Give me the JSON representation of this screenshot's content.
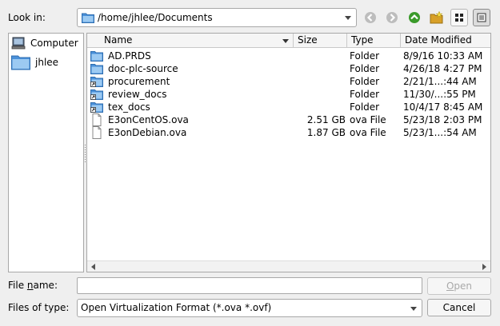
{
  "lookin": {
    "label": "Look in:",
    "path": "/home/jhlee/Documents"
  },
  "toolbar": {
    "back_icon": "arrow-left-icon",
    "forward_icon": "arrow-right-icon",
    "up_icon": "arrow-up-icon",
    "new_folder_icon": "new-folder-icon",
    "icon_view_icon": "grid-view-icon",
    "detail_view_icon": "list-view-icon"
  },
  "sidebar": {
    "items": [
      {
        "label": "Computer",
        "icon": "computer-icon"
      },
      {
        "label": "jhlee",
        "icon": "folder-icon"
      }
    ]
  },
  "columns": {
    "name": "Name",
    "size": "Size",
    "type": "Type",
    "date": "Date Modified"
  },
  "files": [
    {
      "name": "AD.PRDS",
      "size": "",
      "type": "Folder",
      "date": "8/9/16 10:33 AM",
      "icon": "folder"
    },
    {
      "name": "doc-plc-source",
      "size": "",
      "type": "Folder",
      "date": "4/26/18 4:27 PM",
      "icon": "folder"
    },
    {
      "name": "procurement",
      "size": "",
      "type": "Folder",
      "date": "2/21/1...:44 AM",
      "icon": "folder-link"
    },
    {
      "name": "review_docs",
      "size": "",
      "type": "Folder",
      "date": "11/30/...:55 PM",
      "icon": "folder-link"
    },
    {
      "name": "tex_docs",
      "size": "",
      "type": "Folder",
      "date": "10/4/17 8:45 AM",
      "icon": "folder-link"
    },
    {
      "name": "E3onCentOS.ova",
      "size": "2.51 GB",
      "type": "ova File",
      "date": "5/23/18 2:03 PM",
      "icon": "file"
    },
    {
      "name": "E3onDebian.ova",
      "size": "1.87 GB",
      "type": "ova File",
      "date": "5/23/1...:54 AM",
      "icon": "file"
    }
  ],
  "filename": {
    "label_pre": "File ",
    "label_ul": "n",
    "label_post": "ame:",
    "value": ""
  },
  "filetype": {
    "label": "Files of type:",
    "selected": "Open Virtualization Format (*.ova *.ovf)"
  },
  "buttons": {
    "open_ul": "O",
    "open_rest": "pen",
    "cancel": "Cancel"
  },
  "colors": {
    "folder": "#4a90d9",
    "folder_light": "#9ccaf2",
    "up_arrow": "#3a9a2a",
    "disabled": "#a9a9a9"
  }
}
